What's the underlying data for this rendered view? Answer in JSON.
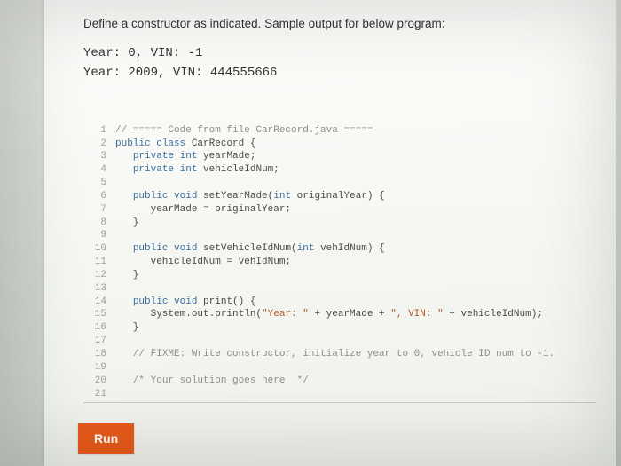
{
  "prompt": "Define a constructor as indicated. Sample output for below program:",
  "sample_lines": [
    "Year: 0, VIN: -1",
    "Year: 2009, VIN: 444555666"
  ],
  "code_lines": [
    {
      "n": 1,
      "html": "<span class='cm'>// ===== Code from file CarRecord.java =====</span>"
    },
    {
      "n": 2,
      "html": "<span class='kw'>public</span> <span class='kw'>class</span> CarRecord {"
    },
    {
      "n": 3,
      "html": "   <span class='kw'>private</span> <span class='type'>int</span> yearMade;"
    },
    {
      "n": 4,
      "html": "   <span class='kw'>private</span> <span class='type'>int</span> vehicleIdNum;"
    },
    {
      "n": 5,
      "html": ""
    },
    {
      "n": 6,
      "html": "   <span class='kw'>public</span> <span class='type'>void</span> setYearMade(<span class='type'>int</span> originalYear) {"
    },
    {
      "n": 7,
      "html": "      yearMade = originalYear;"
    },
    {
      "n": 8,
      "html": "   }"
    },
    {
      "n": 9,
      "html": ""
    },
    {
      "n": 10,
      "html": "   <span class='kw'>public</span> <span class='type'>void</span> setVehicleIdNum(<span class='type'>int</span> vehIdNum) {"
    },
    {
      "n": 11,
      "html": "      vehicleIdNum = vehIdNum;"
    },
    {
      "n": 12,
      "html": "   }"
    },
    {
      "n": 13,
      "html": ""
    },
    {
      "n": 14,
      "html": "   <span class='kw'>public</span> <span class='type'>void</span> print() {"
    },
    {
      "n": 15,
      "html": "      System.out.println(<span class='str'>\"Year: \"</span> + yearMade + <span class='str'>\", VIN: \"</span> + vehicleIdNum);"
    },
    {
      "n": 16,
      "html": "   }"
    },
    {
      "n": 17,
      "html": ""
    },
    {
      "n": 18,
      "html": "   <span class='cm'>// FIXME: Write constructor, initialize year to 0, vehicle ID num to -1.</span>"
    },
    {
      "n": 19,
      "html": ""
    },
    {
      "n": 20,
      "html": "   <span class='cm'>/* Your solution goes here  */</span>"
    },
    {
      "n": 21,
      "html": ""
    }
  ],
  "run_label": "Run"
}
